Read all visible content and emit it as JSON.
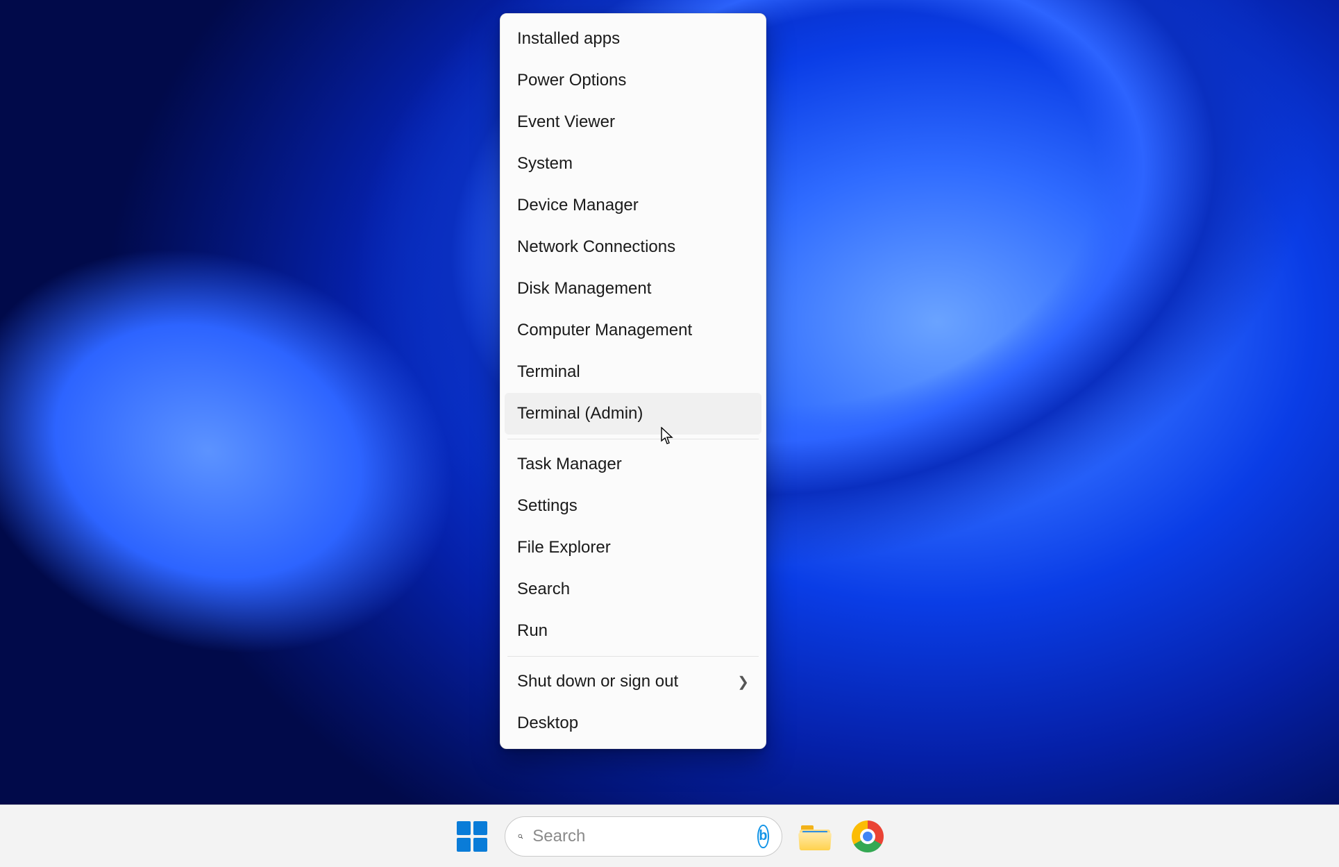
{
  "menu": {
    "items": [
      {
        "label": "Installed apps",
        "submenu": false
      },
      {
        "label": "Power Options",
        "submenu": false
      },
      {
        "label": "Event Viewer",
        "submenu": false
      },
      {
        "label": "System",
        "submenu": false
      },
      {
        "label": "Device Manager",
        "submenu": false
      },
      {
        "label": "Network Connections",
        "submenu": false
      },
      {
        "label": "Disk Management",
        "submenu": false
      },
      {
        "label": "Computer Management",
        "submenu": false
      },
      {
        "label": "Terminal",
        "submenu": false
      },
      {
        "label": "Terminal (Admin)",
        "submenu": false,
        "highlighted": true
      }
    ],
    "items2": [
      {
        "label": "Task Manager",
        "submenu": false
      },
      {
        "label": "Settings",
        "submenu": false
      },
      {
        "label": "File Explorer",
        "submenu": false
      },
      {
        "label": "Search",
        "submenu": false
      },
      {
        "label": "Run",
        "submenu": false
      }
    ],
    "items3": [
      {
        "label": "Shut down or sign out",
        "submenu": true
      },
      {
        "label": "Desktop",
        "submenu": false
      }
    ]
  },
  "taskbar": {
    "search_placeholder": "Search",
    "bing_label": "b",
    "apps": {
      "start": "Start",
      "file_explorer": "File Explorer",
      "chrome": "Google Chrome"
    }
  }
}
